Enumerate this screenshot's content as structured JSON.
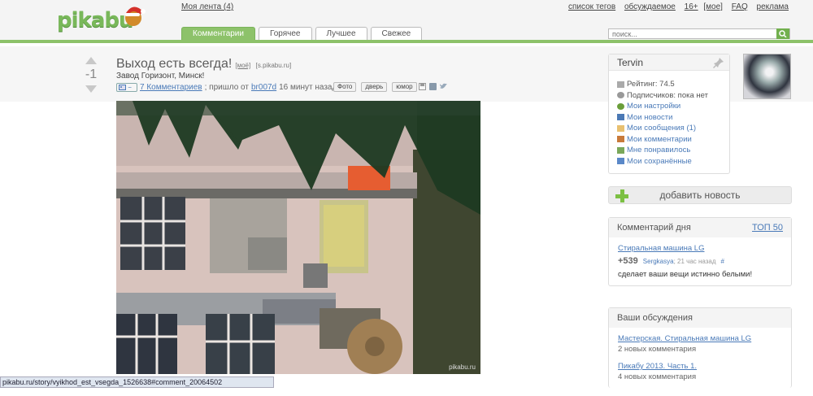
{
  "header": {
    "logo_text": "pikabu",
    "my_feed": "Моя лента (4)",
    "top_links": [
      "список тегов",
      "обсуждаемое",
      "16+",
      "[мое]",
      "FAQ",
      "реклама"
    ],
    "tabs": [
      "Комментарии",
      "Горячее",
      "Лучшее",
      "Свежее"
    ],
    "active_tab": "Комментарии",
    "search_placeholder": "поиск..."
  },
  "post": {
    "score": "-1",
    "title": "Выход есть всегда!",
    "title_tag_mine": "[моё]",
    "title_source": "[s.pikabu.ru]",
    "subtitle": "Завод Горизонт, Минск!",
    "image_toggle": "−",
    "comments_link": "7 Комментариев",
    "posted_from": "; пришло от",
    "author": "br007d",
    "time_ago": "16 минут назад",
    "tags": [
      "Фото",
      "дверь",
      "юмор"
    ],
    "photo_credit": "pikabu.ru"
  },
  "profile": {
    "username": "Tervin",
    "rating": "Рейтинг: 74.5",
    "subscribers": "Подписчиков: пока нет",
    "links": [
      {
        "label": "Мои настройки",
        "icon": "gear-icon"
      },
      {
        "label": "Мои новости",
        "icon": "news-icon"
      },
      {
        "label": "Мои сообщения (1)",
        "icon": "envelope-icon"
      },
      {
        "label": "Мои комментарии",
        "icon": "comment-icon"
      },
      {
        "label": "Мне понравилось",
        "icon": "thumb-icon"
      },
      {
        "label": "Мои сохранённые",
        "icon": "save-icon"
      }
    ]
  },
  "add_news": "добавить новость",
  "comment_of_day": {
    "title": "Комментарий дня",
    "top_link": "ТОП 50",
    "post_link": "Стиральная машина LG",
    "score": "+539",
    "user": "Sergkasya",
    "time": "; 21 час назад",
    "hash": "#",
    "text": "сделает ваши вещи истинно белыми!"
  },
  "discussions": {
    "title": "Ваши обсуждения",
    "items": [
      {
        "title": "Мастерская. Стиральная машина LG",
        "sub": "2 новых комментария"
      },
      {
        "title": "Пикабу 2013. Часть 1.",
        "sub": "4 новых комментария"
      }
    ]
  },
  "statusbar": "pikabu.ru/story/vyikhod_est_vsegda_1526638#comment_20064502",
  "colors": {
    "brand_green": "#8dc26a",
    "link_blue": "#4a7ab8"
  }
}
